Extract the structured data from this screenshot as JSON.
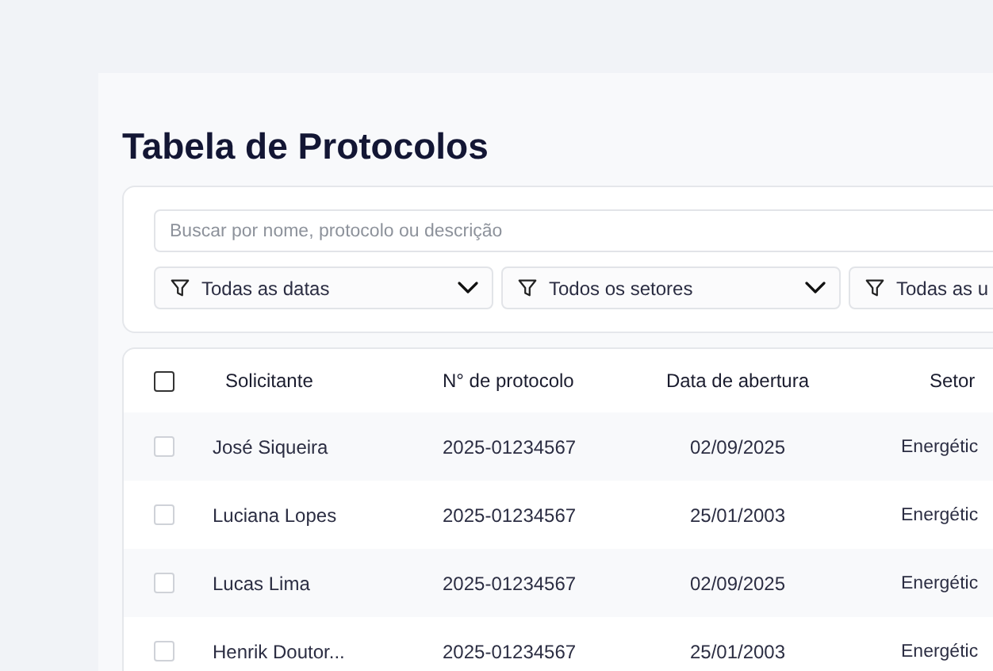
{
  "title": "Tabela de Protocolos",
  "search": {
    "placeholder": "Buscar por nome, protocolo ou descrição"
  },
  "filters": [
    {
      "label": "Todas as datas"
    },
    {
      "label": "Todos os setores"
    },
    {
      "label": "Todas as u"
    }
  ],
  "table": {
    "select_all": {
      "checked": false
    },
    "columns": [
      "Solicitante",
      "N° de protocolo",
      "Data de abertura",
      "Setor"
    ],
    "rows": [
      {
        "checked": false,
        "cells": [
          "José Siqueira",
          "2025-01234567",
          "02/09/2025",
          "Energétic"
        ]
      },
      {
        "checked": false,
        "cells": [
          "Luciana Lopes",
          "2025-01234567",
          "25/01/2003",
          "Energétic"
        ]
      },
      {
        "checked": false,
        "cells": [
          "Lucas Lima",
          "2025-01234567",
          "02/09/2025",
          "Energétic"
        ]
      },
      {
        "checked": false,
        "cells": [
          "Henrik Doutor...",
          "2025-01234567",
          "25/01/2003",
          "Energétic"
        ]
      }
    ]
  }
}
